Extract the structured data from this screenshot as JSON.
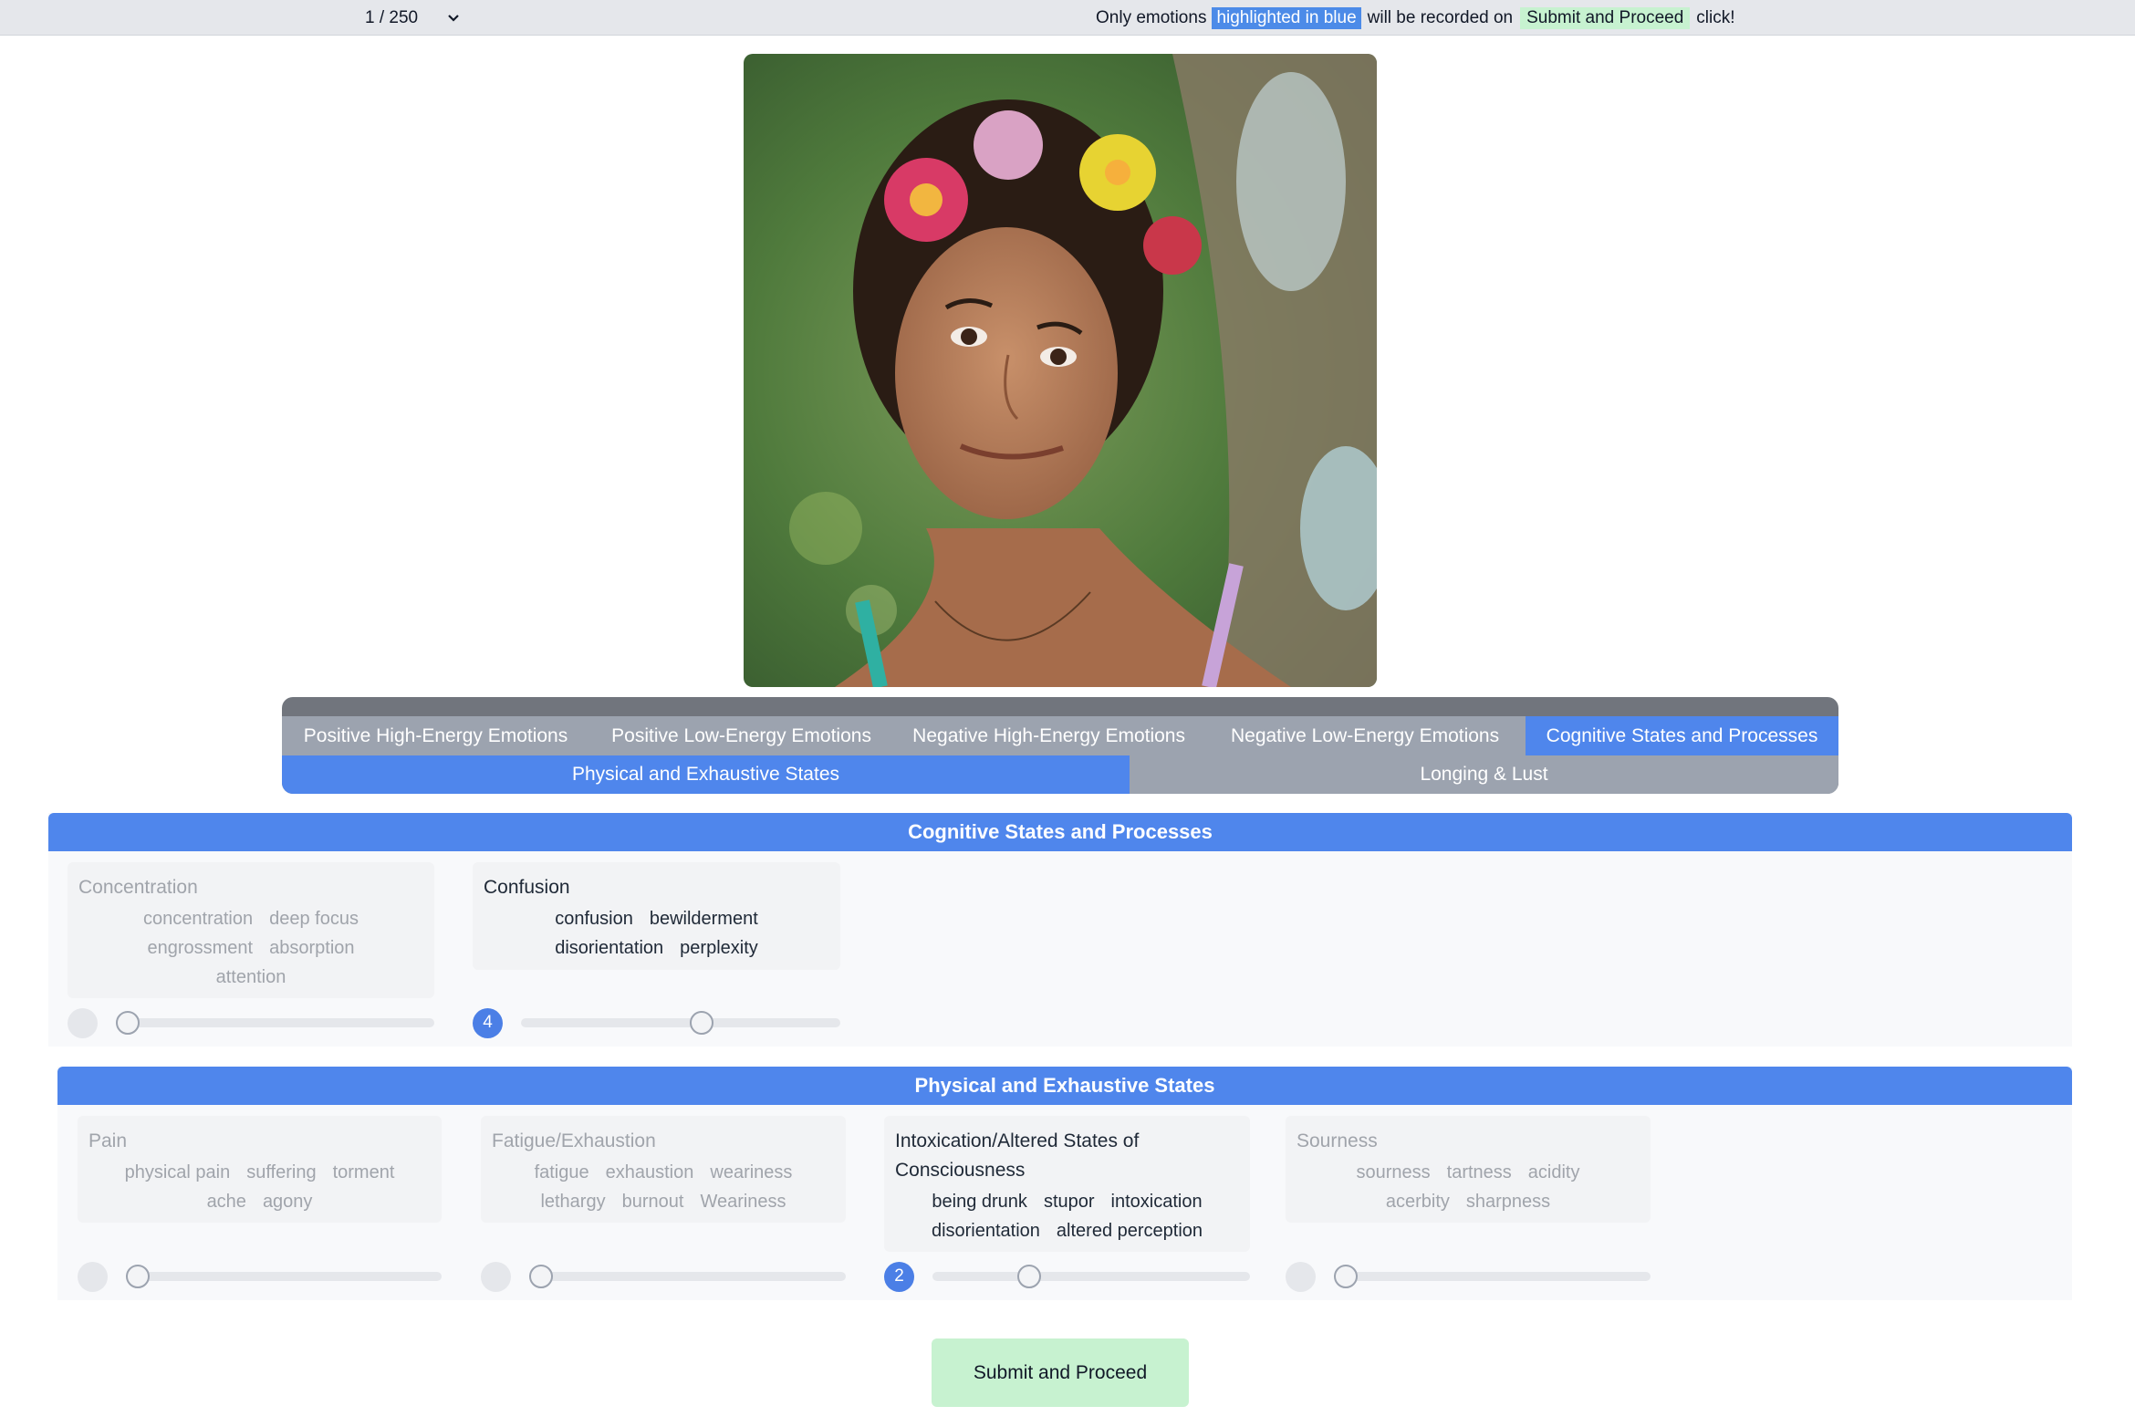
{
  "topbar": {
    "counter": "1 / 250",
    "notice_prefix": "Only emotions",
    "notice_blue": "highlighted in blue",
    "notice_middle": "will be recorded on",
    "notice_green": "Submit and Proceed",
    "notice_suffix": "click!"
  },
  "tabs": [
    {
      "label": "Positive High-Energy Emotions",
      "active": false
    },
    {
      "label": "Positive Low-Energy Emotions",
      "active": false
    },
    {
      "label": "Negative High-Energy Emotions",
      "active": false
    },
    {
      "label": "Negative Low-Energy Emotions",
      "active": false
    },
    {
      "label": "Cognitive States and Processes",
      "active": true
    },
    {
      "label": "Physical and Exhaustive States",
      "active": true
    },
    {
      "label": "Longing & Lust",
      "active": false
    }
  ],
  "sections": [
    {
      "title": "Cognitive States and Processes",
      "cards": [
        {
          "title": "Concentration",
          "words": [
            "concentration",
            "deep focus",
            "engrossment",
            "absorption",
            "attention"
          ],
          "selected": false,
          "value": null,
          "level": 0
        },
        {
          "title": "Confusion",
          "words": [
            "confusion",
            "bewilderment",
            "disorientation",
            "perplexity"
          ],
          "selected": true,
          "value": "4",
          "level": 0.57
        }
      ]
    },
    {
      "title": "Physical and Exhaustive States",
      "cards": [
        {
          "title": "Pain",
          "words": [
            "physical pain",
            "suffering",
            "torment",
            "ache",
            "agony"
          ],
          "selected": false,
          "value": null,
          "level": 0
        },
        {
          "title": "Fatigue/Exhaustion",
          "words": [
            "fatigue",
            "exhaustion",
            "weariness",
            "lethargy",
            "burnout",
            "Weariness"
          ],
          "selected": false,
          "value": null,
          "level": 0
        },
        {
          "title": "Intoxication/Altered States of Consciousness",
          "words": [
            "being drunk",
            "stupor",
            "intoxication",
            "disorientation",
            "altered perception"
          ],
          "selected": true,
          "value": "2",
          "level": 0.29
        },
        {
          "title": "Sourness",
          "words": [
            "sourness",
            "tartness",
            "acidity",
            "acerbity",
            "sharpness"
          ],
          "selected": false,
          "value": null,
          "level": 0
        }
      ]
    }
  ],
  "submit_label": "Submit and Proceed",
  "colors": {
    "accent": "#4f86ec",
    "inactive_tab": "#9ca3af",
    "submit": "#c7f2d0"
  }
}
